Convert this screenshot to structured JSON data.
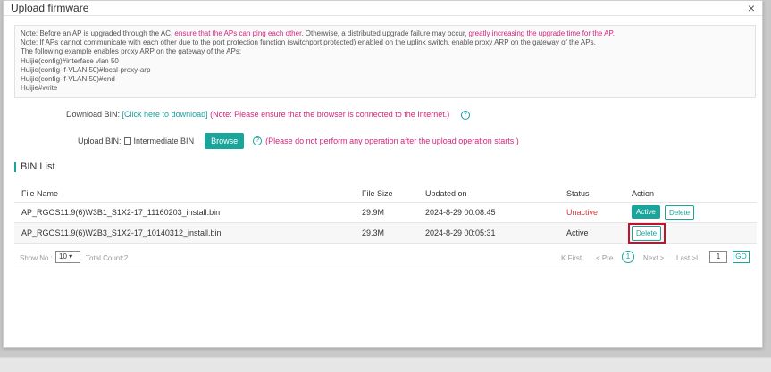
{
  "modal": {
    "title": "Upload firmware",
    "close_icon": "×"
  },
  "note": {
    "line1_a": "Note: Before an AP is upgraded through the AC, ",
    "line1_b": "ensure that the APs can ping each other",
    "line1_c": ". Otherwise, a distributed upgrade failure may occur, ",
    "line1_d": "greatly increasing the upgrade time for the AP.",
    "line2": "Note: If APs cannot communicate with each other due to the port protection function (switchport protected) enabled on the uplink switch, enable proxy ARP on the gateway of the APs.",
    "line3": "The following example enables proxy ARP on the gateway of the APs:",
    "line4": "Huijie(config)#interface vlan 50",
    "line5": "Huijie(config-if-VLAN 50)#local-proxy-arp",
    "line6": "Huijie(config-if-VLAN 50)#end",
    "line7": "Huijie#write"
  },
  "download": {
    "label": "Download BIN:",
    "link": "[Click here to download]",
    "note": "(Note: Please ensure that the browser is connected to the Internet.)",
    "help_icon": "?"
  },
  "upload": {
    "label": "Upload BIN:",
    "checkbox_label": "Intermediate BIN",
    "browse": "Browse",
    "help_icon": "?",
    "note": "(Please do not perform any operation after the upload operation starts.)"
  },
  "bin_list": {
    "title": "BIN List",
    "columns": [
      "File Name",
      "File Size",
      "Updated on",
      "Status",
      "Action"
    ],
    "rows": [
      {
        "file": "AP_RGOS11.9(6)W3B1_S1X2-17_11160203_install.bin",
        "size": "29.9M",
        "updated": "2024-8-29 00:08:45",
        "status": "Unactive",
        "active_btn": "Active",
        "delete_btn": "Delete"
      },
      {
        "file": "AP_RGOS11.9(6)W2B3_S1X2-17_10140312_install.bin",
        "size": "29.3M",
        "updated": "2024-8-29 00:05:31",
        "status": "Active",
        "delete_btn": "Delete"
      }
    ]
  },
  "pager": {
    "show_no": "Show No.:",
    "page_size": "10",
    "total": "Total Count:2",
    "first": "First",
    "prev": "Pre",
    "current": "1",
    "next": "Next",
    "last": "Last",
    "input_value": "1",
    "go": "GO"
  },
  "colors": {
    "accent": "#1aa59a",
    "warn": "#d4237a",
    "highlight": "#c8102e"
  }
}
